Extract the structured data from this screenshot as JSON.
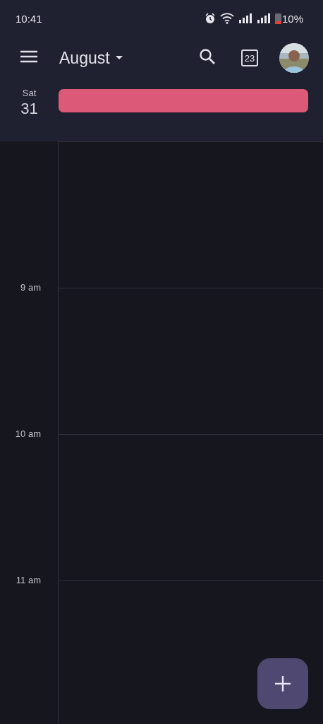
{
  "status_bar": {
    "time": "10:41",
    "battery_text": "10%"
  },
  "app_bar": {
    "title": "August",
    "today_day": "23"
  },
  "day": {
    "weekday": "Sat",
    "date": "31"
  },
  "all_day_events": [
    {
      "color": "#dc5a78"
    }
  ],
  "hours": [
    "9 am",
    "10 am",
    "11 am"
  ]
}
